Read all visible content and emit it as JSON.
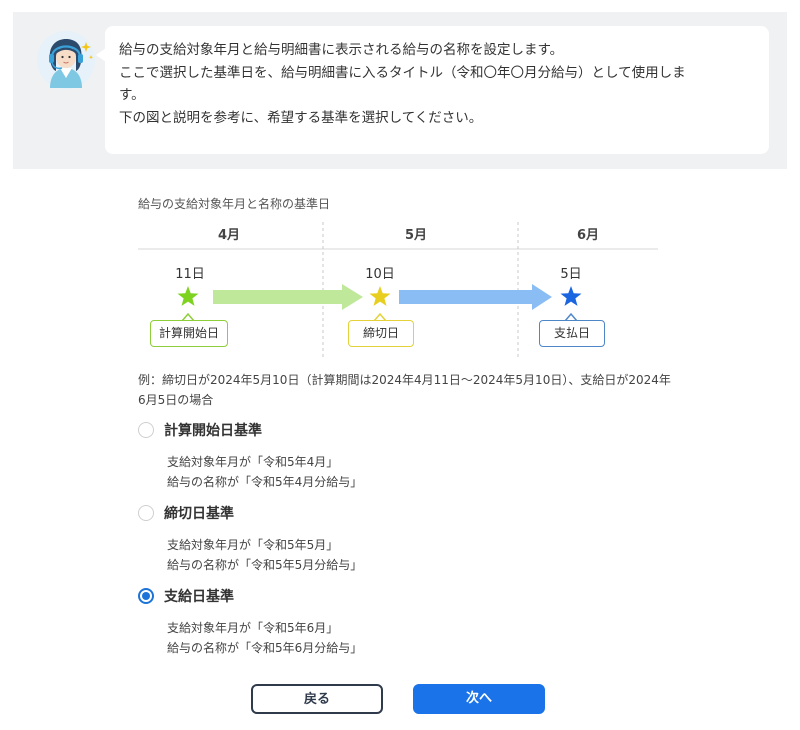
{
  "intro": {
    "lines": [
      "給与の支給対象年月と給与明細書に表示される給与の名称を設定します。",
      "ここで選択した基準日を、給与明細書に入るタイトル（令和〇年〇月分給与）として使用しま",
      "す。",
      "下の図と説明を参考に、希望する基準を選択してください。"
    ]
  },
  "diagram": {
    "title": "給与の支給対象年月と名称の基準日",
    "months": [
      "4月",
      "5月",
      "6月"
    ],
    "events": [
      {
        "day": "11日",
        "label": "計算開始日",
        "color": "#7ed321",
        "border": "#8fce3b"
      },
      {
        "day": "10日",
        "label": "締切日",
        "color": "#e8cf1f",
        "border": "#e3d23a"
      },
      {
        "day": "5日",
        "label": "支払日",
        "color": "#1a66e0",
        "border": "#4f86c8"
      }
    ],
    "arrow_colors": [
      "#bfe89a",
      "#8bbdf5"
    ]
  },
  "example": {
    "text": "例：締切日が2024年5月10日（計算期間は2024年4月11日～2024年5月10日）、支給日が2024年6月5日の場合"
  },
  "options": [
    {
      "label": "計算開始日基準",
      "checked": false,
      "desc1": "支給対象年月が「令和5年4月」",
      "desc2": "給与の名称が「令和5年4月分給与」"
    },
    {
      "label": "締切日基準",
      "checked": false,
      "desc1": "支給対象年月が「令和5年5月」",
      "desc2": "給与の名称が「令和5年5月分給与」"
    },
    {
      "label": "支給日基準",
      "checked": true,
      "desc1": "支給対象年月が「令和5年6月」",
      "desc2": "給与の名称が「令和5年6月分給与」"
    }
  ],
  "buttons": {
    "back": "戻る",
    "next": "次へ"
  }
}
